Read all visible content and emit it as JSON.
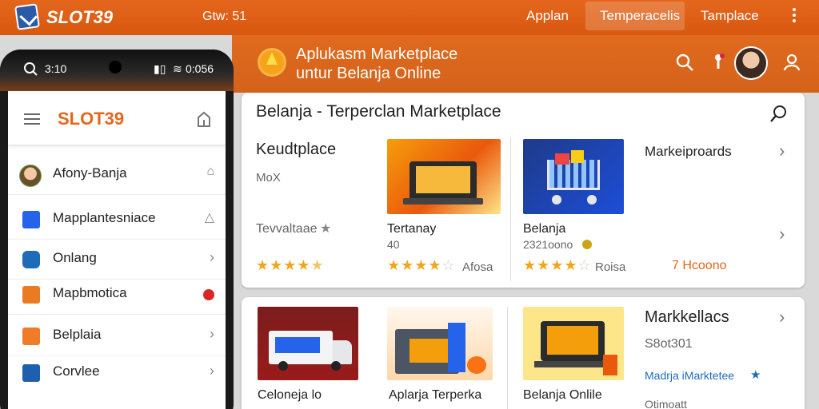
{
  "topbar": {
    "brand": "SLOT39",
    "meta": "Gtw: 51",
    "links": [
      "Applan",
      "Temperacelis",
      "Tamplace"
    ]
  },
  "header": {
    "title_line1": "Aplukasm Marketplace",
    "title_line2": "untur Belanja Online"
  },
  "phone": {
    "status_time": "3:10",
    "status_right": "0:056",
    "app_title": "SLOT39",
    "items": [
      {
        "label": "Afony-Banja",
        "icon": "avatar"
      },
      {
        "label": "Mapplantesniace",
        "icon": "document-icon"
      },
      {
        "label": "Onlang",
        "icon": "bag-icon"
      },
      {
        "label": "Mapbmotica",
        "icon": "list-icon"
      },
      {
        "label": "Belplaia",
        "icon": "folder-icon"
      },
      {
        "label": "Corvlee",
        "icon": "app-icon"
      }
    ]
  },
  "section1": {
    "title": "Belanja - Terperclan Marketplace",
    "col1": {
      "title": "Keudtplace",
      "sub": "MoX",
      "label": "Tevvaltaae"
    },
    "col2": {
      "name": "Tertanay",
      "value": "40",
      "rating_label": "Afosa"
    },
    "col3": {
      "name": "Belanja",
      "value": "2321oono",
      "rating_label": "Roisa"
    },
    "col4": {
      "title": "Markeiproards",
      "price": "7 Hcoono"
    },
    "ratings": [
      4.5,
      3.5,
      3.5
    ]
  },
  "section2": {
    "items": [
      "Celoneja lo",
      "Aplarja  Terperka",
      "Belanja Onlile"
    ],
    "side": {
      "title": "Markkellacs",
      "sub": "S8ot301",
      "link": "Madrja iMarktetee",
      "foot": "Otimoatt"
    }
  },
  "colors": {
    "accent": "#e4661c",
    "star": "#f2a518",
    "link": "#1e6bb8"
  }
}
